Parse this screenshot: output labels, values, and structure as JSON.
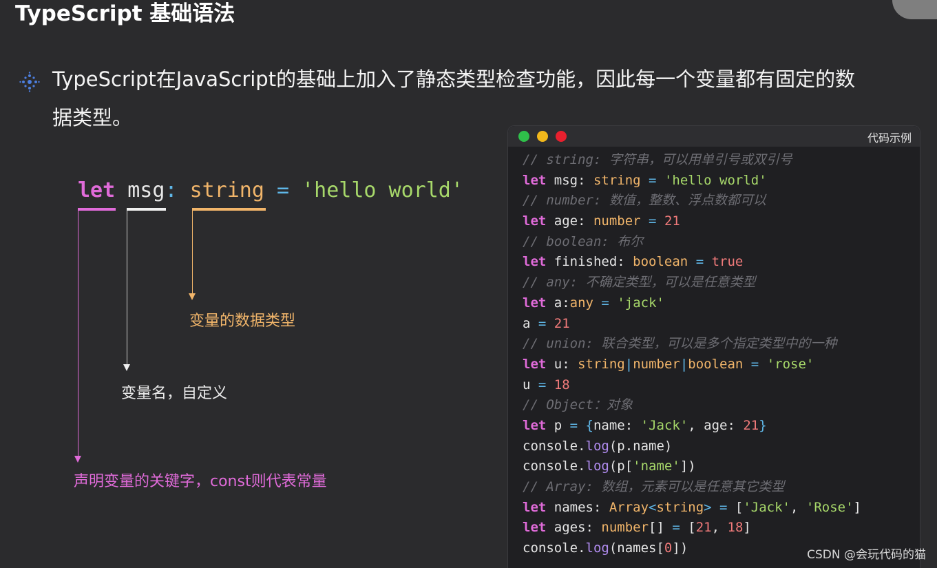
{
  "slide": {
    "title": "TypeScript 基础语法",
    "desc_line1": "TypeScript在JavaScript的基础上加入了静态类型检查功能，因此每一个变量都有固定的数",
    "desc_line2": "据类型。"
  },
  "diagram": {
    "code": {
      "kw": "let",
      "name": "msg",
      "colon": ":",
      "type": "string",
      "eq": "=",
      "value": "'hello world'"
    },
    "note_type": "变量的数据类型",
    "note_name": "变量名，自定义",
    "note_kw": "声明变量的关键字，const则代表常量"
  },
  "window": {
    "title": "代码示例",
    "lines": [
      [
        {
          "c": "cm",
          "t": "// string: 字符串，可以用单引号或双引号"
        }
      ],
      [
        {
          "c": "ck",
          "t": "let"
        },
        {
          "c": "",
          "t": " msg: "
        },
        {
          "c": "ct",
          "t": "string"
        },
        {
          "c": "co",
          "t": " = "
        },
        {
          "c": "cs",
          "t": "'hello world'"
        }
      ],
      [
        {
          "c": "cm",
          "t": "// number: 数值，整数、浮点数都可以"
        }
      ],
      [
        {
          "c": "ck",
          "t": "let"
        },
        {
          "c": "",
          "t": " age: "
        },
        {
          "c": "ct",
          "t": "number"
        },
        {
          "c": "co",
          "t": " = "
        },
        {
          "c": "cn",
          "t": "21"
        }
      ],
      [
        {
          "c": "cm",
          "t": "// boolean: 布尔"
        }
      ],
      [
        {
          "c": "ck",
          "t": "let"
        },
        {
          "c": "",
          "t": " finished: "
        },
        {
          "c": "ct",
          "t": "boolean"
        },
        {
          "c": "co",
          "t": " = "
        },
        {
          "c": "cn",
          "t": "true"
        }
      ],
      [
        {
          "c": "cm",
          "t": "// any: 不确定类型，可以是任意类型"
        }
      ],
      [
        {
          "c": "ck",
          "t": "let"
        },
        {
          "c": "",
          "t": " a:"
        },
        {
          "c": "ct",
          "t": "any"
        },
        {
          "c": "co",
          "t": " = "
        },
        {
          "c": "cs",
          "t": "'jack'"
        }
      ],
      [
        {
          "c": "",
          "t": "a"
        },
        {
          "c": "co",
          "t": " = "
        },
        {
          "c": "cn",
          "t": "21"
        }
      ],
      [
        {
          "c": "cm",
          "t": "// union: 联合类型，可以是多个指定类型中的一种"
        }
      ],
      [
        {
          "c": "ck",
          "t": "let"
        },
        {
          "c": "",
          "t": " u: "
        },
        {
          "c": "ct",
          "t": "string"
        },
        {
          "c": "co",
          "t": "|"
        },
        {
          "c": "ct",
          "t": "number"
        },
        {
          "c": "co",
          "t": "|"
        },
        {
          "c": "ct",
          "t": "boolean"
        },
        {
          "c": "co",
          "t": " = "
        },
        {
          "c": "cs",
          "t": "'rose'"
        }
      ],
      [
        {
          "c": "",
          "t": "u"
        },
        {
          "c": "co",
          "t": " = "
        },
        {
          "c": "cn",
          "t": "18"
        }
      ],
      [
        {
          "c": "cm",
          "t": "// Object：对象"
        }
      ],
      [
        {
          "c": "ck",
          "t": "let"
        },
        {
          "c": "",
          "t": " p "
        },
        {
          "c": "co",
          "t": "= {"
        },
        {
          "c": "",
          "t": "name: "
        },
        {
          "c": "cs",
          "t": "'Jack'"
        },
        {
          "c": "",
          "t": ", age: "
        },
        {
          "c": "cn",
          "t": "21"
        },
        {
          "c": "co",
          "t": "}"
        }
      ],
      [
        {
          "c": "",
          "t": "console."
        },
        {
          "c": "cf",
          "t": "log"
        },
        {
          "c": "",
          "t": "(p.name)"
        }
      ],
      [
        {
          "c": "",
          "t": "console."
        },
        {
          "c": "cf",
          "t": "log"
        },
        {
          "c": "",
          "t": "(p["
        },
        {
          "c": "cs",
          "t": "'name'"
        },
        {
          "c": "",
          "t": "])"
        }
      ],
      [
        {
          "c": "cm",
          "t": "// Array: 数组，元素可以是任意其它类型"
        }
      ],
      [
        {
          "c": "ck",
          "t": "let"
        },
        {
          "c": "",
          "t": " names: "
        },
        {
          "c": "ct",
          "t": "Array"
        },
        {
          "c": "co",
          "t": "<"
        },
        {
          "c": "ct",
          "t": "string"
        },
        {
          "c": "co",
          "t": "> = "
        },
        {
          "c": "",
          "t": "["
        },
        {
          "c": "cs",
          "t": "'Jack'"
        },
        {
          "c": "",
          "t": ", "
        },
        {
          "c": "cs",
          "t": "'Rose'"
        },
        {
          "c": "",
          "t": "]"
        }
      ],
      [
        {
          "c": "ck",
          "t": "let"
        },
        {
          "c": "",
          "t": " ages: "
        },
        {
          "c": "ct",
          "t": "number"
        },
        {
          "c": "",
          "t": "[]"
        },
        {
          "c": "co",
          "t": " = "
        },
        {
          "c": "",
          "t": "["
        },
        {
          "c": "cn",
          "t": "21"
        },
        {
          "c": "",
          "t": ", "
        },
        {
          "c": "cn",
          "t": "18"
        },
        {
          "c": "",
          "t": "]"
        }
      ],
      [
        {
          "c": "",
          "t": "console."
        },
        {
          "c": "cf",
          "t": "log"
        },
        {
          "c": "",
          "t": "(names["
        },
        {
          "c": "cn",
          "t": "0"
        },
        {
          "c": "",
          "t": "])"
        }
      ]
    ]
  },
  "watermark": "CSDN @会玩代码的猫",
  "colors": {
    "keyword": "#e06bd9",
    "type": "#f1b56a",
    "string": "#a7d86a",
    "number": "#f07a7a",
    "comment": "#6d6d73"
  }
}
